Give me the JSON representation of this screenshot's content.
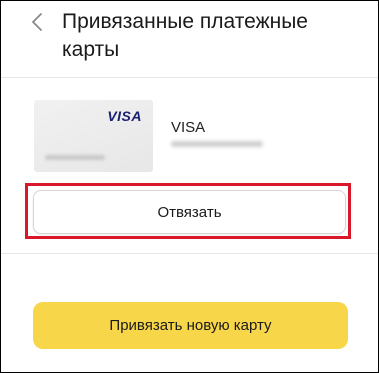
{
  "header": {
    "back_icon": "chevron-left-icon",
    "title": "Привязанные платежные карты"
  },
  "card": {
    "brand_logo": "VISA",
    "label": "VISA"
  },
  "actions": {
    "unlink_label": "Отвязать",
    "add_card_label": "Привязать новую карту"
  },
  "colors": {
    "highlight": "#d9182b",
    "primary_button": "#f8d64a",
    "visa_brand": "#1a1f71"
  }
}
